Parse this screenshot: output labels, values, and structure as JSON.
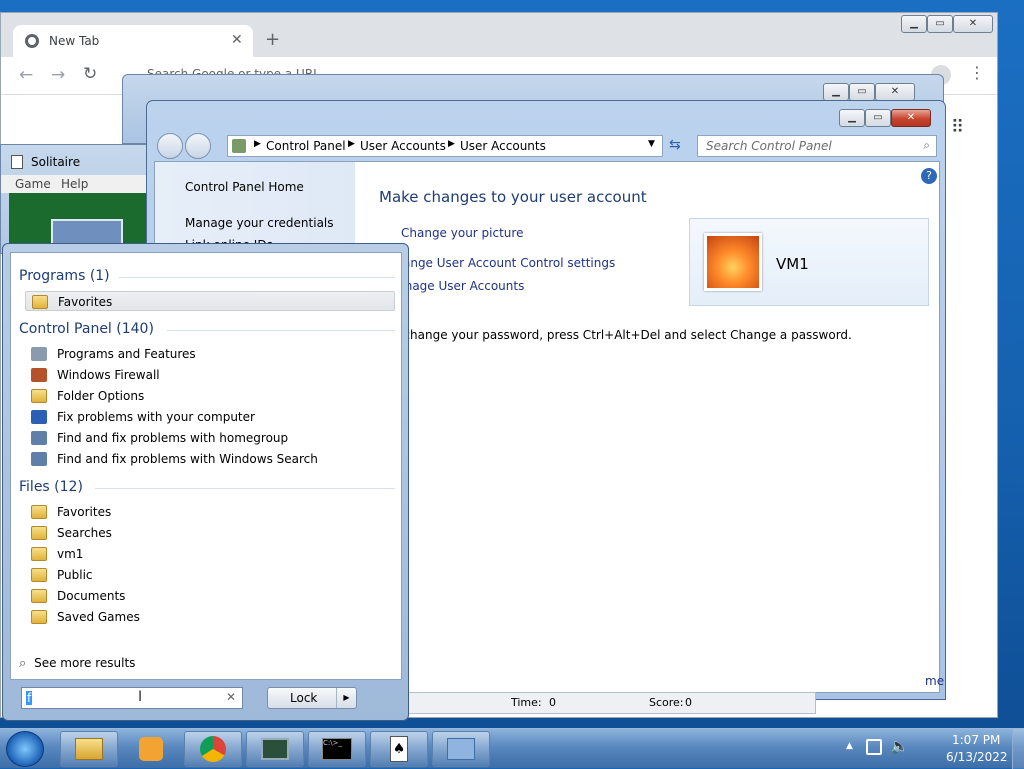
{
  "chrome": {
    "tab_title": "New Tab",
    "omnibox_placeholder": "Search Google or type a URL"
  },
  "solitaire": {
    "title": "Solitaire",
    "menu": [
      "Game",
      "Help"
    ],
    "time_label": "Time:",
    "time_value": "0",
    "score_label": "Score:",
    "score_value": "0"
  },
  "control_panel": {
    "breadcrumb": [
      "Control Panel",
      "User Accounts",
      "User Accounts"
    ],
    "search_placeholder": "Search Control Panel",
    "nav": {
      "home": "Control Panel Home",
      "credentials": "Manage your credentials",
      "link_id": "Link online IDs"
    },
    "heading": "Make changes to your user account",
    "links": [
      "Change your picture",
      "Change User Account Control settings",
      "Manage User Accounts"
    ],
    "password_text": "To change your password, press Ctrl+Alt+Del and select Change a password.",
    "user_name": "VM1",
    "truncated_right_text": "me"
  },
  "start_menu": {
    "programs_header": "Programs (1)",
    "programs": [
      "Favorites"
    ],
    "control_panel_header": "Control Panel (140)",
    "control_panel_items": [
      "Programs and Features",
      "Windows Firewall",
      "Folder Options",
      "Fix problems with your computer",
      "Find and fix problems with homegroup",
      "Find and fix problems with Windows Search"
    ],
    "files_header": "Files (12)",
    "files": [
      "Favorites",
      "Searches",
      "vm1",
      "Public",
      "Documents",
      "Saved Games"
    ],
    "see_more": "See more results",
    "search_value": "f",
    "lock_label": "Lock"
  },
  "taskbar": {
    "time": "1:07 PM",
    "date": "6/13/2022"
  },
  "colors": {
    "link": "#1e3287",
    "header": "#1e3d73",
    "desktop": "#1767b8"
  }
}
